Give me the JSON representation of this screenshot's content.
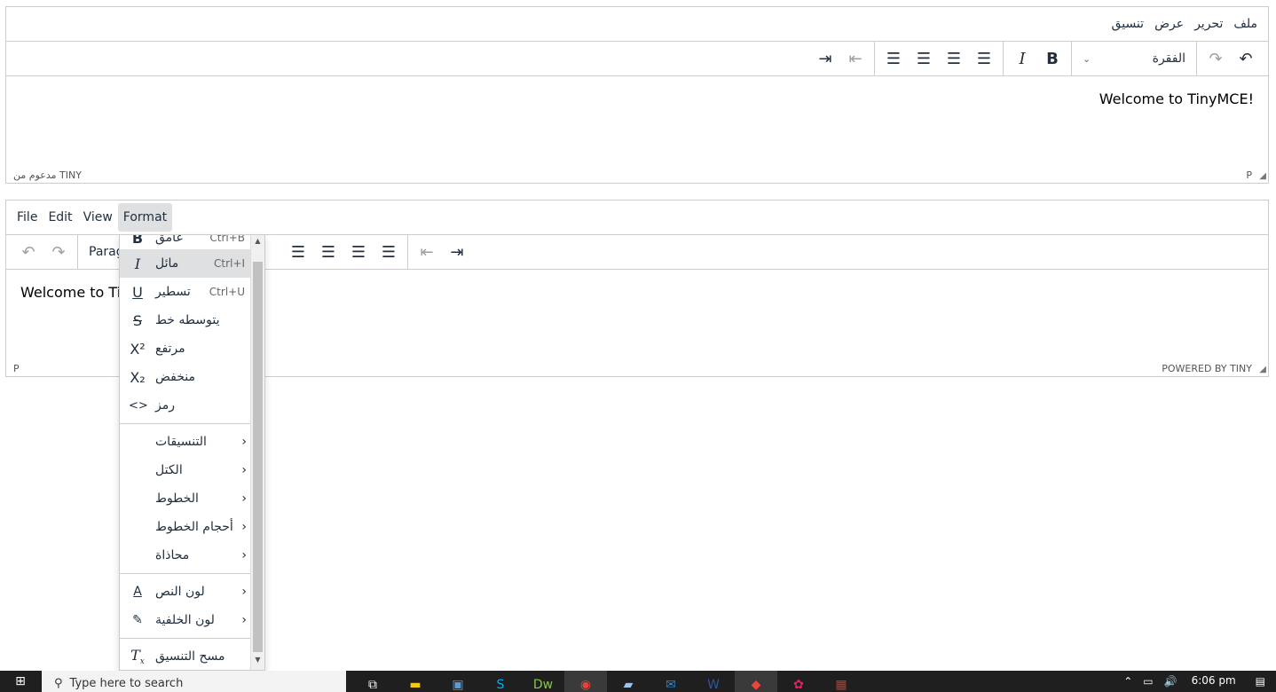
{
  "rtl_editor": {
    "menu": [
      "ملف",
      "تحرير",
      "عرض",
      "تنسيق"
    ],
    "block_format": "الفقرة",
    "content": "Welcome to TinyMCE!",
    "status_left": "P",
    "status_right": "مدعوم من TINY"
  },
  "ltr_editor": {
    "menu": [
      "File",
      "Edit",
      "View",
      "Format"
    ],
    "block_format": "Paragr",
    "content": "Welcome to Tin",
    "status_left": "P",
    "status_right": "POWERED BY TINY"
  },
  "format_menu": {
    "items": [
      {
        "label": "غامق",
        "shortcut": "Ctrl+B",
        "icon": "bold-icon"
      },
      {
        "label": "مائل",
        "shortcut": "Ctrl+I",
        "icon": "italic-icon"
      },
      {
        "label": "تسطير",
        "shortcut": "Ctrl+U",
        "icon": "underline-icon"
      },
      {
        "label": "يتوسطه خط",
        "shortcut": "",
        "icon": "strikethrough-icon"
      },
      {
        "label": "مرتفع",
        "shortcut": "",
        "icon": "superscript-icon"
      },
      {
        "label": "منخفض",
        "shortcut": "",
        "icon": "subscript-icon"
      },
      {
        "label": "رمز",
        "shortcut": "",
        "icon": "code-icon"
      }
    ],
    "submenus": [
      "التنسيقات",
      "الكتل",
      "الخطوط",
      "أحجام الخطوط",
      "محاذاة"
    ],
    "colors": [
      "لون النص",
      "لون الخلفية"
    ],
    "clear": "مسح التنسيق"
  },
  "taskbar": {
    "search_placeholder": "Type here to search",
    "time": "6:06 pm"
  }
}
